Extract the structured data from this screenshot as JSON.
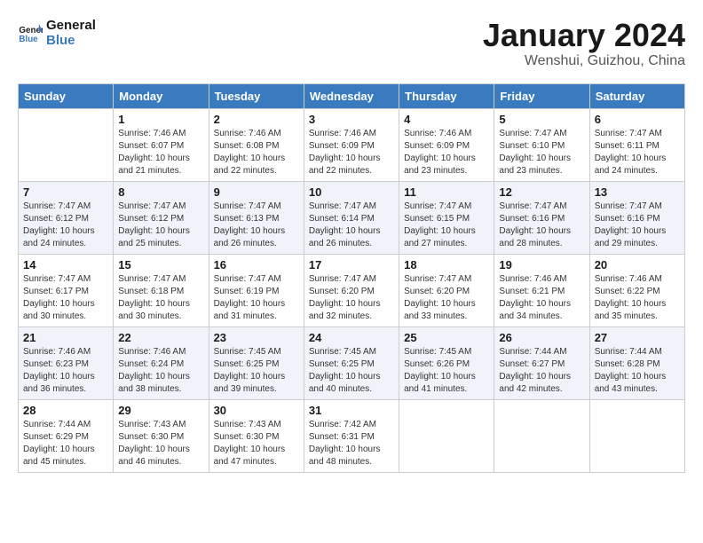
{
  "logo": {
    "text_general": "General",
    "text_blue": "Blue"
  },
  "title": "January 2024",
  "subtitle": "Wenshui, Guizhou, China",
  "headers": [
    "Sunday",
    "Monday",
    "Tuesday",
    "Wednesday",
    "Thursday",
    "Friday",
    "Saturday"
  ],
  "weeks": [
    [
      {
        "day": "",
        "sunrise": "",
        "sunset": "",
        "daylight": ""
      },
      {
        "day": "1",
        "sunrise": "7:46 AM",
        "sunset": "6:07 PM",
        "daylight": "10 hours and 21 minutes."
      },
      {
        "day": "2",
        "sunrise": "7:46 AM",
        "sunset": "6:08 PM",
        "daylight": "10 hours and 22 minutes."
      },
      {
        "day": "3",
        "sunrise": "7:46 AM",
        "sunset": "6:09 PM",
        "daylight": "10 hours and 22 minutes."
      },
      {
        "day": "4",
        "sunrise": "7:46 AM",
        "sunset": "6:09 PM",
        "daylight": "10 hours and 23 minutes."
      },
      {
        "day": "5",
        "sunrise": "7:47 AM",
        "sunset": "6:10 PM",
        "daylight": "10 hours and 23 minutes."
      },
      {
        "day": "6",
        "sunrise": "7:47 AM",
        "sunset": "6:11 PM",
        "daylight": "10 hours and 24 minutes."
      }
    ],
    [
      {
        "day": "7",
        "sunrise": "7:47 AM",
        "sunset": "6:12 PM",
        "daylight": "10 hours and 24 minutes."
      },
      {
        "day": "8",
        "sunrise": "7:47 AM",
        "sunset": "6:12 PM",
        "daylight": "10 hours and 25 minutes."
      },
      {
        "day": "9",
        "sunrise": "7:47 AM",
        "sunset": "6:13 PM",
        "daylight": "10 hours and 26 minutes."
      },
      {
        "day": "10",
        "sunrise": "7:47 AM",
        "sunset": "6:14 PM",
        "daylight": "10 hours and 26 minutes."
      },
      {
        "day": "11",
        "sunrise": "7:47 AM",
        "sunset": "6:15 PM",
        "daylight": "10 hours and 27 minutes."
      },
      {
        "day": "12",
        "sunrise": "7:47 AM",
        "sunset": "6:16 PM",
        "daylight": "10 hours and 28 minutes."
      },
      {
        "day": "13",
        "sunrise": "7:47 AM",
        "sunset": "6:16 PM",
        "daylight": "10 hours and 29 minutes."
      }
    ],
    [
      {
        "day": "14",
        "sunrise": "7:47 AM",
        "sunset": "6:17 PM",
        "daylight": "10 hours and 30 minutes."
      },
      {
        "day": "15",
        "sunrise": "7:47 AM",
        "sunset": "6:18 PM",
        "daylight": "10 hours and 30 minutes."
      },
      {
        "day": "16",
        "sunrise": "7:47 AM",
        "sunset": "6:19 PM",
        "daylight": "10 hours and 31 minutes."
      },
      {
        "day": "17",
        "sunrise": "7:47 AM",
        "sunset": "6:20 PM",
        "daylight": "10 hours and 32 minutes."
      },
      {
        "day": "18",
        "sunrise": "7:47 AM",
        "sunset": "6:20 PM",
        "daylight": "10 hours and 33 minutes."
      },
      {
        "day": "19",
        "sunrise": "7:46 AM",
        "sunset": "6:21 PM",
        "daylight": "10 hours and 34 minutes."
      },
      {
        "day": "20",
        "sunrise": "7:46 AM",
        "sunset": "6:22 PM",
        "daylight": "10 hours and 35 minutes."
      }
    ],
    [
      {
        "day": "21",
        "sunrise": "7:46 AM",
        "sunset": "6:23 PM",
        "daylight": "10 hours and 36 minutes."
      },
      {
        "day": "22",
        "sunrise": "7:46 AM",
        "sunset": "6:24 PM",
        "daylight": "10 hours and 38 minutes."
      },
      {
        "day": "23",
        "sunrise": "7:45 AM",
        "sunset": "6:25 PM",
        "daylight": "10 hours and 39 minutes."
      },
      {
        "day": "24",
        "sunrise": "7:45 AM",
        "sunset": "6:25 PM",
        "daylight": "10 hours and 40 minutes."
      },
      {
        "day": "25",
        "sunrise": "7:45 AM",
        "sunset": "6:26 PM",
        "daylight": "10 hours and 41 minutes."
      },
      {
        "day": "26",
        "sunrise": "7:44 AM",
        "sunset": "6:27 PM",
        "daylight": "10 hours and 42 minutes."
      },
      {
        "day": "27",
        "sunrise": "7:44 AM",
        "sunset": "6:28 PM",
        "daylight": "10 hours and 43 minutes."
      }
    ],
    [
      {
        "day": "28",
        "sunrise": "7:44 AM",
        "sunset": "6:29 PM",
        "daylight": "10 hours and 45 minutes."
      },
      {
        "day": "29",
        "sunrise": "7:43 AM",
        "sunset": "6:30 PM",
        "daylight": "10 hours and 46 minutes."
      },
      {
        "day": "30",
        "sunrise": "7:43 AM",
        "sunset": "6:30 PM",
        "daylight": "10 hours and 47 minutes."
      },
      {
        "day": "31",
        "sunrise": "7:42 AM",
        "sunset": "6:31 PM",
        "daylight": "10 hours and 48 minutes."
      },
      {
        "day": "",
        "sunrise": "",
        "sunset": "",
        "daylight": ""
      },
      {
        "day": "",
        "sunrise": "",
        "sunset": "",
        "daylight": ""
      },
      {
        "day": "",
        "sunrise": "",
        "sunset": "",
        "daylight": ""
      }
    ]
  ],
  "labels": {
    "sunrise_prefix": "Sunrise: ",
    "sunset_prefix": "Sunset: ",
    "daylight_prefix": "Daylight: "
  }
}
